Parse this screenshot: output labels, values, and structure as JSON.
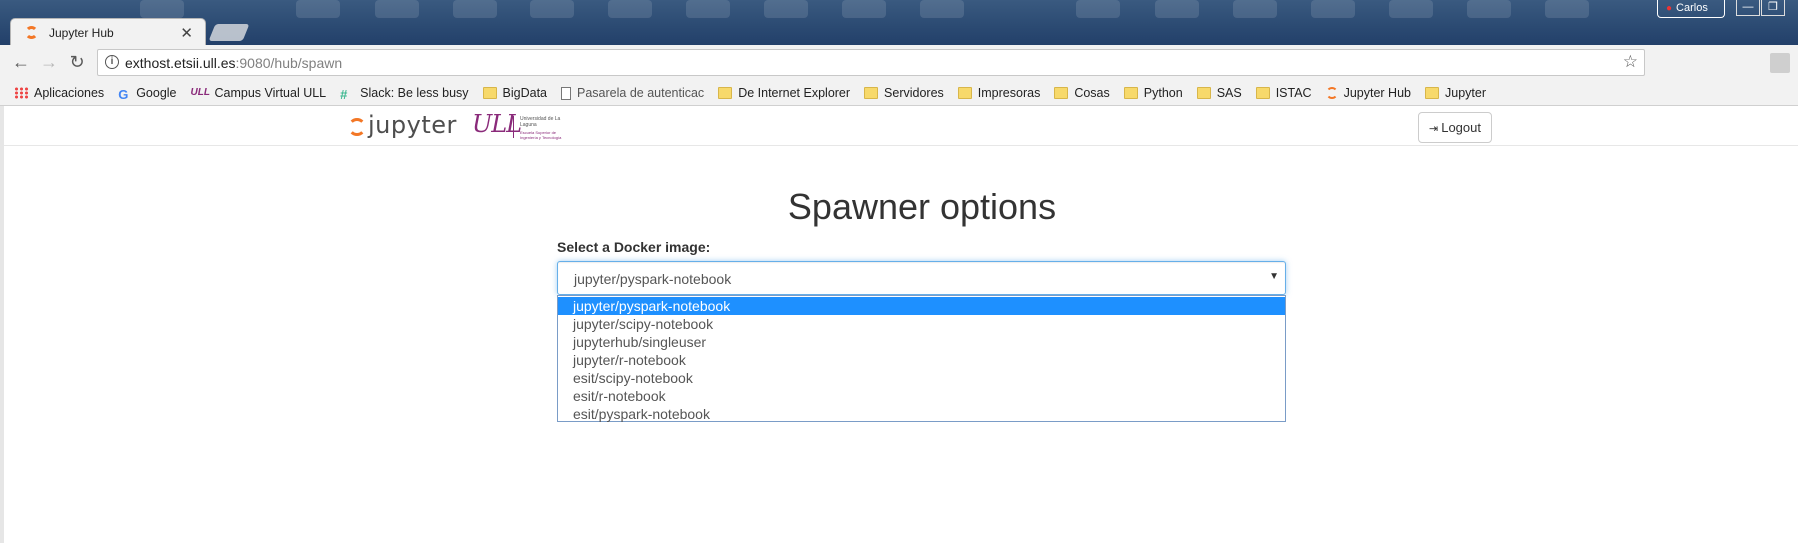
{
  "browser": {
    "tab_title": "Jupyter Hub",
    "tab_close": "✕",
    "window_user": "Carlos",
    "window_controls": [
      "—",
      "❐",
      "✕"
    ],
    "url_host": "exthost.etsii.ull.es",
    "url_path": ":9080/hub/spawn",
    "bookmarks": [
      {
        "label": "Aplicaciones",
        "icon": "apps-icon"
      },
      {
        "label": "Google",
        "icon": "google-icon"
      },
      {
        "label": "Campus Virtual ULL",
        "icon": "ull-icon"
      },
      {
        "label": "Slack: Be less busy",
        "icon": "slack-icon"
      },
      {
        "label": "BigData",
        "icon": "folder-icon"
      },
      {
        "label": "Pasarela de autenticac",
        "icon": "page-icon"
      },
      {
        "label": "De Internet Explorer",
        "icon": "folder-icon"
      },
      {
        "label": "Servidores",
        "icon": "folder-icon"
      },
      {
        "label": "Impresoras",
        "icon": "folder-icon"
      },
      {
        "label": "Cosas",
        "icon": "folder-icon"
      },
      {
        "label": "Python",
        "icon": "folder-icon"
      },
      {
        "label": "SAS",
        "icon": "folder-icon"
      },
      {
        "label": "ISTAC",
        "icon": "folder-icon"
      },
      {
        "label": "Jupyter Hub",
        "icon": "jupyter-icon"
      },
      {
        "label": "Jupyter",
        "icon": "folder-icon"
      }
    ]
  },
  "header": {
    "jupyter_word": "jupyter",
    "ull_mark": "ULL",
    "ull_text1": "Universidad de La Laguna",
    "ull_text2": "Escuela Superior de Ingeniería y Tecnología",
    "logout_label": "Logout"
  },
  "main": {
    "title": "Spawner options",
    "select_label": "Select a Docker image:",
    "selected_image": "jupyter/pyspark-notebook",
    "options": [
      "jupyter/pyspark-notebook",
      "jupyter/scipy-notebook",
      "jupyterhub/singleuser",
      "jupyter/r-notebook",
      "esit/scipy-notebook",
      "esit/r-notebook",
      "esit/pyspark-notebook"
    ],
    "highlighted_index": 0
  },
  "colors": {
    "jupyter_orange": "#f37726",
    "ull_purple": "#8a2a7a",
    "option_highlight": "#1e90ff",
    "focus_border": "#66afe9"
  }
}
